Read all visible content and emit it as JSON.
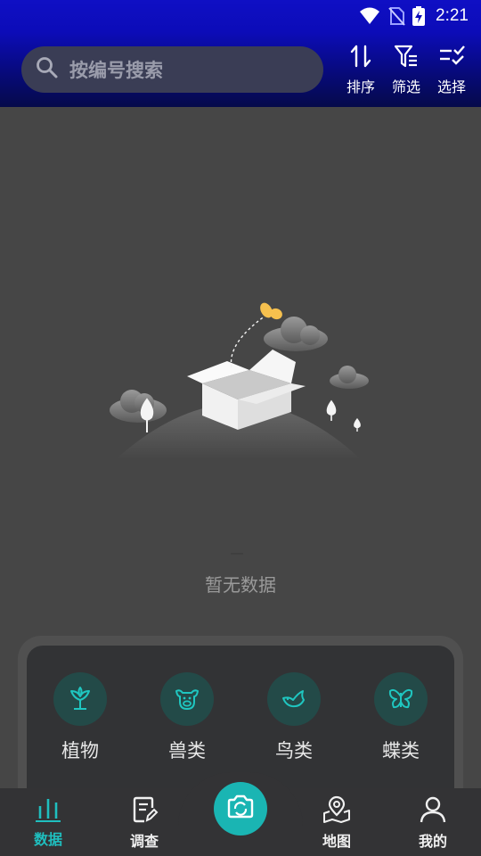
{
  "status_bar": {
    "time": "2:21"
  },
  "header": {
    "search_placeholder": "按编号搜索",
    "sort_label": "排序",
    "filter_label": "筛选",
    "select_label": "选择"
  },
  "empty_state": {
    "message": "暂无数据"
  },
  "categories": [
    {
      "label": "植物",
      "icon": "plant-icon"
    },
    {
      "label": "兽类",
      "icon": "mammal-icon"
    },
    {
      "label": "鸟类",
      "icon": "bird-icon"
    },
    {
      "label": "蝶类",
      "icon": "butterfly-icon"
    }
  ],
  "bottom_nav": {
    "items": [
      {
        "label": "数据",
        "icon": "data-bars-icon",
        "active": true
      },
      {
        "label": "调查",
        "icon": "survey-edit-icon",
        "active": false
      },
      {
        "label": "",
        "icon": "camera-icon",
        "active": false
      },
      {
        "label": "地图",
        "icon": "map-pin-icon",
        "active": false
      },
      {
        "label": "我的",
        "icon": "user-icon",
        "active": false
      }
    ]
  },
  "colors": {
    "accent": "#1ab5b3",
    "header_top": "#0c0cb8",
    "background": "#464646",
    "panel": "#323335",
    "category_circle": "#234a48"
  }
}
